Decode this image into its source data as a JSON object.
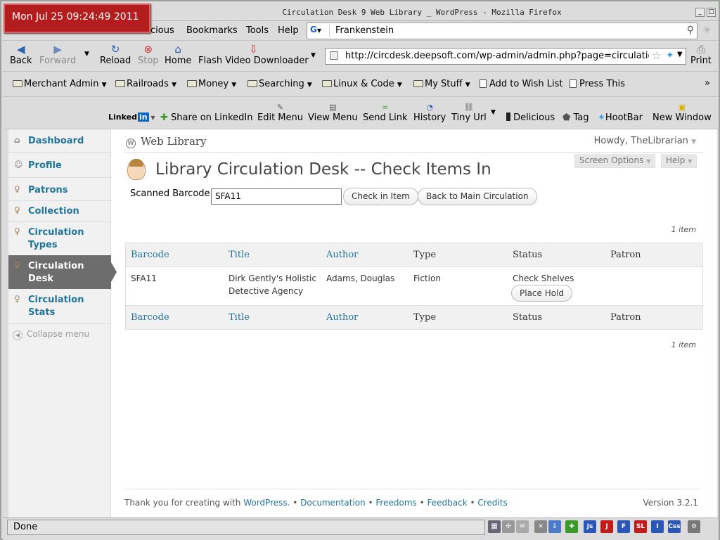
{
  "clock": "Mon Jul 25 09:24:49 2011",
  "window_title": "Circulation Desk  9 Web Library  _ WordPress - Mozilla Firefox",
  "menu": [
    "cious",
    "Bookmarks",
    "Tools",
    "Help"
  ],
  "search_box": {
    "engine": "G",
    "value": "Frankenstein"
  },
  "nav": {
    "back": "Back",
    "forward": "Forward",
    "reload": "Reload",
    "stop": "Stop",
    "home": "Home",
    "flash": "Flash Video Downloader",
    "print": "Print",
    "url": "http://circdesk.deepsoft.com/wp-admin/admin.php?page=circulatic"
  },
  "bookmarks": [
    "Merchant Admin",
    "Railroads",
    "Money",
    "Searching",
    "Linux & Code",
    "My Stuff",
    "Add to Wish List",
    "Press This"
  ],
  "extra_toolbar": {
    "linkedin": "Linked",
    "linkedin_in": "in",
    "share": "Share on LinkedIn",
    "edit_menu": "Edit Menu",
    "view_menu": "View Menu",
    "send_link": "Send Link",
    "history": "History",
    "tiny_url": "Tiny Url",
    "delicious": "Delicious",
    "tag": "Tag",
    "hootbar": "HootBar",
    "new_window": "New Window"
  },
  "sidebar": {
    "items": [
      {
        "label": "Dashboard"
      },
      {
        "label": "Profile"
      },
      {
        "label": "Patrons"
      },
      {
        "label": "Collection"
      },
      {
        "label": "Circulation Types"
      },
      {
        "label": "Circulation Desk"
      },
      {
        "label": "Circulation Stats"
      }
    ],
    "collapse": "Collapse menu"
  },
  "header": {
    "site": "Web Library",
    "howdy": "Howdy, TheLibrarian",
    "screen_options": "Screen Options",
    "help": "Help"
  },
  "page": {
    "title": "Library Circulation Desk -- Check Items In",
    "scan_label": "Scanned Barcode",
    "scan_value": "SFA11",
    "check_in_button": "Check in Item",
    "back_button": "Back to Main Circulation",
    "count_top": "1 item",
    "count_bottom": "1 item"
  },
  "table": {
    "headers": [
      "Barcode",
      "Title",
      "Author",
      "Type",
      "Status",
      "Patron"
    ],
    "rows": [
      {
        "barcode": "SFA11",
        "title_line1": "Dirk Gently's Holistic",
        "title_line2": "Detective Agency",
        "author": "Adams, Douglas",
        "type": "Fiction",
        "status": "Check Shelves",
        "action": "Place Hold",
        "patron": ""
      }
    ]
  },
  "footer": {
    "thanks": "Thank you for creating with ",
    "wordpress": "WordPress.",
    "sep": " • ",
    "documentation": "Documentation",
    "freedoms": "Freedoms",
    "feedback": "Feedback",
    "credits": "Credits",
    "version": "Version 3.2.1"
  },
  "status": "Done",
  "status_icons": [
    "Js",
    "J",
    "F",
    "SL",
    "I",
    "Css"
  ],
  "colors": {
    "wp_link": "#21759b",
    "clock_bg": "#b31d1d",
    "menu_current": "#6d6d6d"
  }
}
